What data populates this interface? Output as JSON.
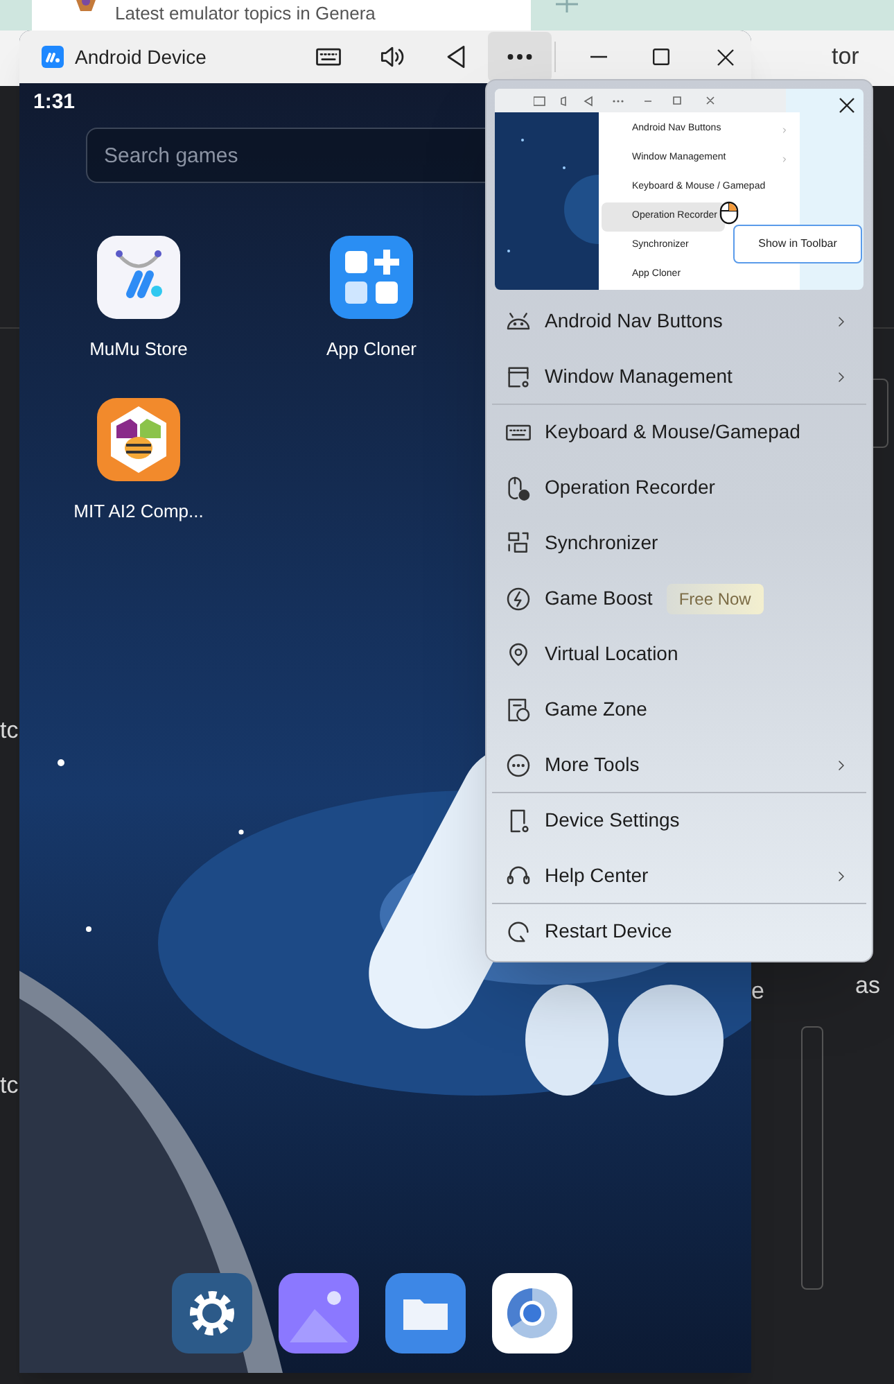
{
  "browser": {
    "tab_title": "Latest emulator topics in Genera"
  },
  "background_fragments": [
    "tor",
    "tc",
    "tc",
    "e",
    "as"
  ],
  "window": {
    "title": "Android Device",
    "toolbar": [
      {
        "kind": "keyboard",
        "selected": false
      },
      {
        "kind": "volume",
        "selected": false
      },
      {
        "kind": "back",
        "selected": false
      },
      {
        "kind": "more",
        "selected": true
      }
    ]
  },
  "device": {
    "time": "1:31",
    "search": {
      "placeholder": "Search games"
    },
    "apps": [
      {
        "label": "MuMu Store",
        "kind": "store"
      },
      {
        "label": "App Cloner",
        "kind": "cloner"
      },
      {
        "label": "MIT AI2 Comp...",
        "kind": "ai2"
      }
    ],
    "dock": [
      {
        "kind": "settings"
      },
      {
        "kind": "gallery"
      },
      {
        "kind": "files"
      },
      {
        "kind": "browser"
      }
    ]
  },
  "menu": {
    "preview": {
      "items": [
        {
          "label": "Android Nav Buttons",
          "submenu": true,
          "selected": false
        },
        {
          "label": "Window Management",
          "submenu": true,
          "selected": false
        },
        {
          "label": "Keyboard & Mouse / Gamepad",
          "submenu": false,
          "selected": false
        },
        {
          "label": "Operation Recorder",
          "submenu": false,
          "selected": true
        },
        {
          "label": "Synchronizer",
          "submenu": false,
          "selected": false
        },
        {
          "label": "App Cloner",
          "submenu": false,
          "selected": false
        }
      ],
      "tooltip": "Show in Toolbar"
    },
    "items": [
      {
        "label": "Android Nav Buttons",
        "kind": "android",
        "submenu": true,
        "divider_before": false
      },
      {
        "label": "Window Management",
        "kind": "window",
        "submenu": true,
        "divider_before": false
      },
      {
        "label": "Keyboard & Mouse/Gamepad",
        "kind": "keyboard",
        "submenu": false,
        "divider_before": true
      },
      {
        "label": "Operation Recorder",
        "kind": "recorder",
        "submenu": false,
        "divider_before": false
      },
      {
        "label": "Synchronizer",
        "kind": "sync",
        "submenu": false,
        "divider_before": false
      },
      {
        "label": "Game Boost",
        "kind": "boost",
        "submenu": false,
        "divider_before": false,
        "badge": "Free Now"
      },
      {
        "label": "Virtual Location",
        "kind": "location",
        "submenu": false,
        "divider_before": false
      },
      {
        "label": "Game Zone",
        "kind": "zone",
        "submenu": false,
        "divider_before": false
      },
      {
        "label": "More Tools",
        "kind": "more",
        "submenu": true,
        "divider_before": false
      },
      {
        "label": "Device Settings",
        "kind": "device",
        "submenu": false,
        "divider_before": true
      },
      {
        "label": "Help Center",
        "kind": "help",
        "submenu": true,
        "divider_before": false
      },
      {
        "label": "Restart Device",
        "kind": "restart",
        "submenu": false,
        "divider_before": true
      }
    ]
  }
}
